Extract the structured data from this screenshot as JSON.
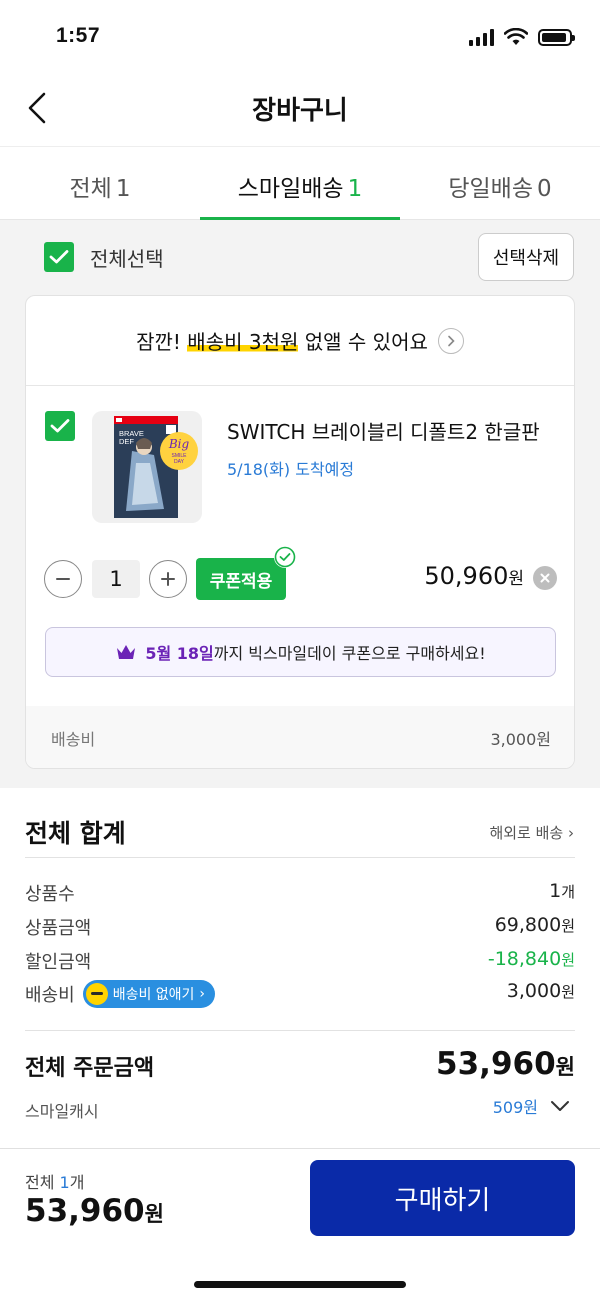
{
  "status_bar": {
    "time": "1:57"
  },
  "header": {
    "title": "장바구니"
  },
  "tabs": [
    {
      "label": "전체",
      "count": "1"
    },
    {
      "label": "스마일배송",
      "count": "1"
    },
    {
      "label": "당일배송",
      "count": "0"
    }
  ],
  "selection": {
    "select_all_label": "전체선택",
    "delete_label": "선택삭제"
  },
  "promo": {
    "prefix": "잠깐! ",
    "highlight": "배송비 3천원",
    "suffix": " 없앨 수 있어요"
  },
  "product": {
    "name": "SWITCH 브레이블리 디폴트2 한글판",
    "delivery": "5/18(화) 도착예정",
    "quantity": "1",
    "coupon_label": "쿠폰적용",
    "price": "50,960",
    "price_unit": "원",
    "badge": {
      "line1": "Big",
      "line2": "SMILE",
      "line3": "DAY"
    },
    "box_title": {
      "line1": "BRAVE",
      "line2": "DEF"
    }
  },
  "coupon_notice": {
    "date": "5월 18일",
    "text": "까지 빅스마일데이 쿠폰으로 구매하세요!"
  },
  "shipping": {
    "label": "배송비",
    "value": "3,000원"
  },
  "totals": {
    "title": "전체 합계",
    "overseas_link": "해외로 배송",
    "rows": [
      {
        "label": "상품수",
        "value": "1",
        "unit": "개"
      },
      {
        "label": "상품금액",
        "value": "69,800",
        "unit": "원"
      },
      {
        "label": "할인금액",
        "value": "-18,840",
        "unit": "원"
      },
      {
        "label": "배송비",
        "value": "3,000",
        "unit": "원"
      }
    ],
    "free_shipping_pill": "배송비 없애기",
    "order_total_label": "전체 주문금액",
    "order_total_value": "53,960",
    "order_total_unit": "원",
    "smile_cash_label": "스마일캐시",
    "smile_cash_value": "509원"
  },
  "bottom_bar": {
    "count_prefix": "전체 ",
    "count_num": "1",
    "count_unit": "개",
    "total": "53,960",
    "total_unit": "원",
    "buy_label": "구매하기"
  },
  "colors": {
    "green": "#19b34a",
    "blue_button": "#0a2aa8",
    "link_blue": "#2a7bd6",
    "purple": "#6b23b6"
  }
}
